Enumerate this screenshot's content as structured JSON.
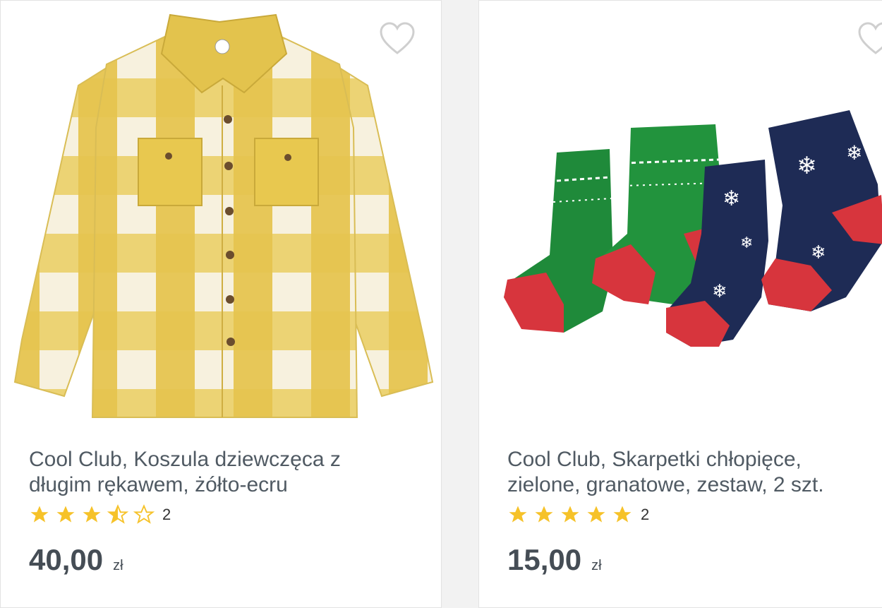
{
  "products": [
    {
      "title_line1": "Cool Club, Koszula dziewczęca z",
      "title_line2": "długim rękawem, żółto-ecru",
      "rating": 3.5,
      "rating_max": 5,
      "review_count": "2",
      "price": "40,00",
      "currency": "zł",
      "image": "yellow-checked-shirt-image"
    },
    {
      "title_line1": "Cool Club, Skarpetki chłopięce,",
      "title_line2": "zielone, granatowe, zestaw, 2 szt.",
      "rating": 5,
      "rating_max": 5,
      "review_count": "2",
      "price": "15,00",
      "currency": "zł",
      "image": "christmas-socks-image"
    }
  ],
  "colors": {
    "star": "#f6c229",
    "heart": "#cfcfcf",
    "title": "#505a63",
    "price": "#454d55"
  }
}
